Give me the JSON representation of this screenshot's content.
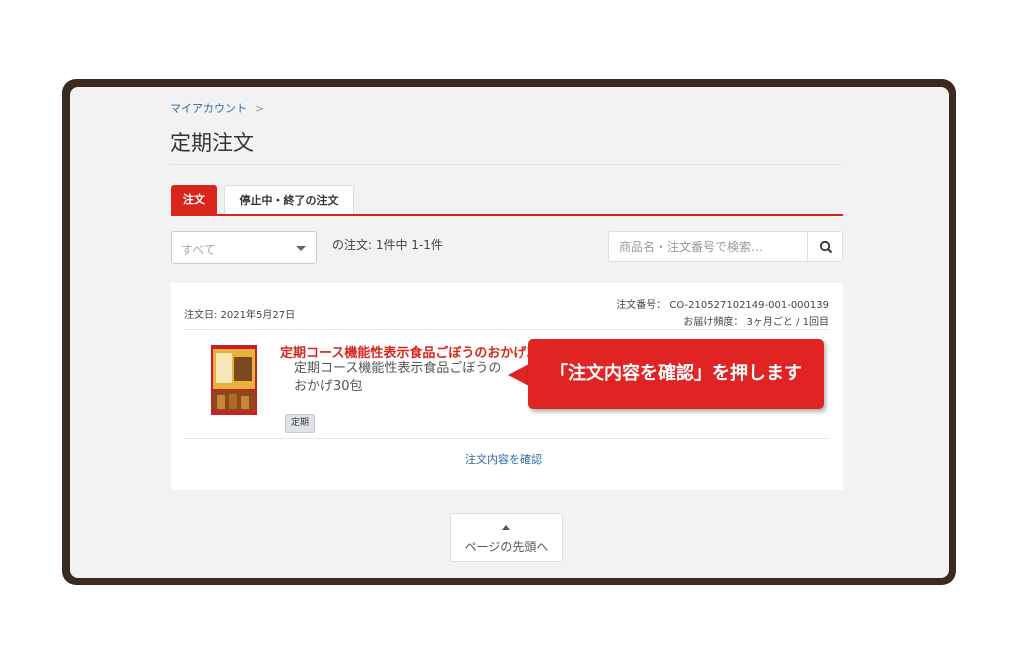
{
  "breadcrumb": {
    "label": "マイアカウント",
    "separator": ">"
  },
  "page_title": "定期注文",
  "tabs": [
    {
      "label": "注文",
      "active": true
    },
    {
      "label": "停止中・終了の注文",
      "active": false
    }
  ],
  "filter": {
    "selected": "すべて"
  },
  "result_count": "の注文: 1件中 1-1件",
  "search": {
    "placeholder": "商品名・注文番号で検索…",
    "icon": "search-icon"
  },
  "order": {
    "date": "注文日: 2021年5月27日",
    "number": "注文番号： CO-210527102149-001-000139",
    "frequency": "お届け頻度： 3ヶ月ごと / 1回目",
    "product_name_highlight": "定期コース機能性表示食品ごぼうのおかげ30包",
    "product_name": "定期コース機能性表示食品ごぼうのおかげ30包",
    "badge": "定期",
    "confirm_link": "注文内容を確認"
  },
  "callout": {
    "text": "「注文内容を確認」を押します"
  },
  "back_to_top": {
    "label": "ページの先頭へ"
  },
  "colors": {
    "accent": "#d9261c",
    "link": "#2f6aa6",
    "frame": "#3a2a20",
    "callout": "#e02424"
  }
}
